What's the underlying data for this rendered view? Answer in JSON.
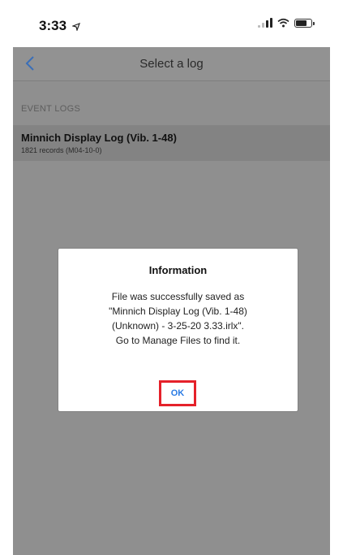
{
  "status_bar": {
    "time": "3:33",
    "location_icon": "location-arrow-icon",
    "signal_icon": "cellular-signal-icon",
    "wifi_icon": "wifi-icon",
    "battery_icon": "battery-icon"
  },
  "nav": {
    "back_icon": "chevron-left-icon",
    "title": "Select a log"
  },
  "section": {
    "header": "EVENT LOGS"
  },
  "logs": [
    {
      "title": "Minnich Display Log (Vib. 1-48)",
      "subtitle": "1821 records (M04-10-0)"
    }
  ],
  "dialog": {
    "title": "Information",
    "message_lines": [
      "File was successfully saved as",
      "\"Minnich Display Log (Vib. 1-48)",
      "(Unknown) - 3-25-20 3.33.irlx\".",
      "Go to Manage Files to find it."
    ],
    "ok_label": "OK"
  },
  "colors": {
    "accent_blue": "#2a7be4",
    "highlight_red": "#e5212a",
    "overlay_gray": "#8f8f8f"
  }
}
